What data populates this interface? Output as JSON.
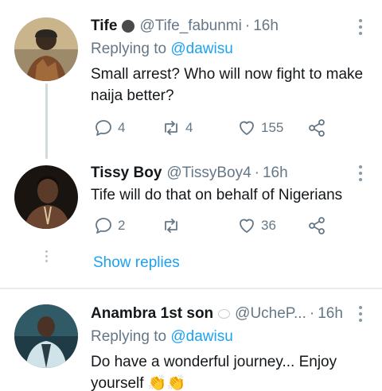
{
  "tweets": [
    {
      "name": "Tife",
      "handle": "@Tife_fabunmi",
      "separator": "·",
      "time": "16h",
      "replying_prefix": "Replying to",
      "replying_to": "@dawisu",
      "text": "Small arrest? Who will now fight to make naija better?",
      "replies": "4",
      "retweets": "4",
      "likes": "155"
    },
    {
      "name": "Tissy Boy",
      "handle": "@TissyBoy4",
      "separator": "·",
      "time": "16h",
      "text": "Tife will do that on behalf of Nigerians",
      "replies": "2",
      "retweets": "",
      "likes": "36"
    },
    {
      "name": "Anambra 1st son",
      "handle": "@UcheP...",
      "separator": "·",
      "time": "16h",
      "replying_prefix": "Replying to",
      "replying_to": "@dawisu",
      "text_line1": "Do have a wonderful journey... Enjoy",
      "text_line2": "yourself",
      "emoji": "👏👏"
    }
  ],
  "show_replies": "Show replies",
  "colors": {
    "accent": "#1da1f2",
    "secondary": "#657786",
    "line": "#cfd9de"
  }
}
